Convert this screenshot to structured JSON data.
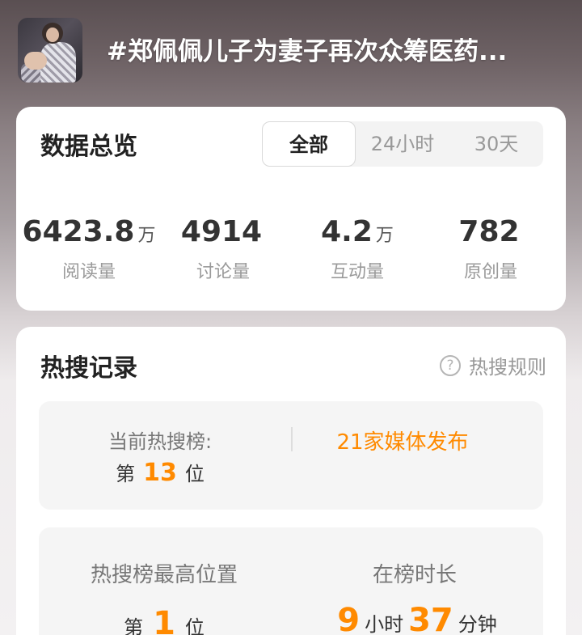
{
  "header": {
    "title": "#郑佩佩儿子为妻子再次众筹医药..."
  },
  "overview": {
    "title": "数据总览",
    "tabs": [
      "全部",
      "24小时",
      "30天"
    ],
    "active_tab": "全部",
    "stats": [
      {
        "value": "6423.8",
        "unit": "万",
        "label": "阅读量"
      },
      {
        "value": "4914",
        "unit": "",
        "label": "讨论量"
      },
      {
        "value": "4.2",
        "unit": "万",
        "label": "互动量"
      },
      {
        "value": "782",
        "unit": "",
        "label": "原创量"
      }
    ]
  },
  "hot_search": {
    "title": "热搜记录",
    "rules_label": "热搜规则",
    "help_icon_glyph": "?",
    "current": {
      "label": "当前热搜榜:",
      "prefix": "第",
      "rank": "13",
      "suffix": "位",
      "media": "21家媒体发布"
    },
    "peak": {
      "label": "热搜榜最高位置",
      "prefix": "第",
      "rank": "1",
      "suffix": "位"
    },
    "duration": {
      "label": "在榜时长",
      "hours": "9",
      "hours_unit": "小时",
      "minutes": "37",
      "minutes_unit": "分钟"
    }
  },
  "colors": {
    "accent": "#ff8a00",
    "card_bg": "#ffffff",
    "panel_bg": "#f5f5f5"
  }
}
